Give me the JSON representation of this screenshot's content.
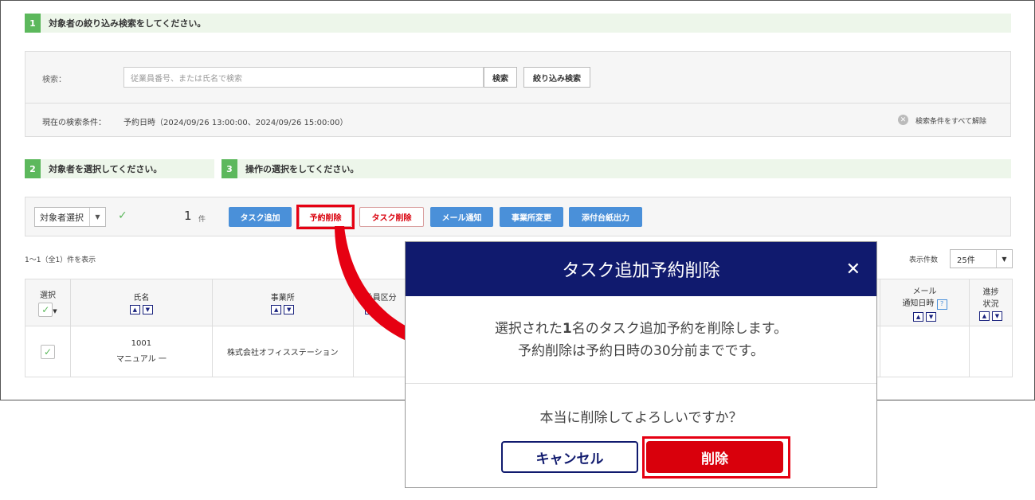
{
  "step1": {
    "num": "1",
    "title": "対象者の絞り込み検索をしてください。"
  },
  "search": {
    "label": "検索：",
    "placeholder": "従業員番号、または氏名で検索",
    "search_btn": "検索",
    "filter_btn": "絞り込み検索"
  },
  "condition": {
    "label": "現在の検索条件：",
    "value": "予約日時（2024/09/26 13:00:00、2024/09/26 15:00:00）",
    "clear": "検索条件をすべて解除"
  },
  "step2": {
    "num": "2",
    "title": "対象者を選択してください。"
  },
  "step3": {
    "num": "3",
    "title": "操作の選択をしてください。"
  },
  "selection": {
    "select_label": "対象者選択",
    "count": "1",
    "count_unit": "件"
  },
  "actions": [
    "タスク追加",
    "予約削除",
    "タスク削除",
    "メール通知",
    "事業所変更",
    "添付台紙出力"
  ],
  "list": {
    "range_text": "1〜1（全1）件を表示",
    "per_page_label": "表示件数",
    "per_page_value": "25件"
  },
  "table": {
    "headers": {
      "select": "選択",
      "name": "氏名",
      "office": "事業所",
      "category": "社員区分",
      "mail_date_1": "メール",
      "mail_date_2": "通知日時",
      "progress_1": "進捗",
      "progress_2": "状況"
    },
    "rows": [
      {
        "id": "1001",
        "name": "マニュアル 一",
        "office": "株式会社オフィスステーション"
      }
    ]
  },
  "modal": {
    "title": "タスク追加予約削除",
    "line1_pre": "選択された",
    "line1_num": "1",
    "line1_post": "名のタスク追加予約を削除します。",
    "line2": "予約削除は予約日時の30分前までです。",
    "question": "本当に削除してよろしいですか？",
    "cancel": "キャンセル",
    "delete": "削除"
  },
  "colors": {
    "accent_green": "#5cb85c",
    "action_blue": "#4a90d9",
    "danger_red": "#d9000c",
    "modal_navy": "#101a6e"
  }
}
